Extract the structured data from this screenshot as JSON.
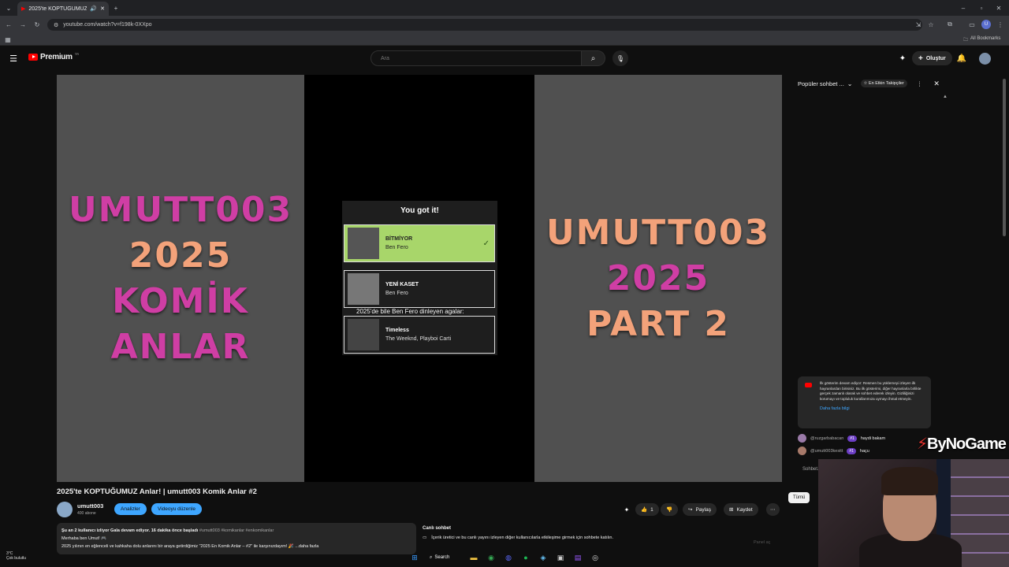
{
  "browser": {
    "tab_title": "2025'te KOPTUĞUMUZ Anlar",
    "url": "youtube.com/watch?v=f198k-0XXpo",
    "bookmarks_label": "All Bookmarks"
  },
  "header": {
    "logo_text": "Premium",
    "logo_region": "TR",
    "search_placeholder": "Ara",
    "create_label": "Oluştur"
  },
  "video": {
    "left_lines": [
      "UMUTT003",
      "2025",
      "KOMİK",
      "ANLAR"
    ],
    "right_lines": [
      "UMUTT003",
      "2025",
      "PART 2"
    ],
    "card_heading": "You got it!",
    "songs": [
      {
        "name": "BİTMİYOR",
        "artist": "Ben Fero"
      },
      {
        "name": "YENİ KASET",
        "artist": "Ben Fero"
      },
      {
        "name": "Timeless",
        "artist": "The Weeknd, Playboi Carti"
      }
    ],
    "caption": "2025'de bile Ben Fero dinleyen agalar:",
    "selected_check": "✓"
  },
  "info": {
    "title": "2025'te KOPTUĞUMUZ Anlar! | umutt003 Komik Anlar #2",
    "channel": "umutt003",
    "subscribers": "400 abone",
    "analytics_label": "Analizler",
    "edit_label": "Videoyu düzenle",
    "like_count": "1",
    "share_label": "Paylaş",
    "save_label": "Kaydet",
    "more_label": "⋯",
    "desc_line1_bold": "Şu an 2 kullanıcı izliyor  Gala devam ediyor. 16 dakika önce başladı",
    "desc_line1_tags": "#umutt003 #komikanlar #enkomikanlar",
    "desc_line2": "Merhaba ben Umut! 🎮",
    "desc_line3": "2025 yılının en eğlenceli ve kahkaha dolu anlarını bir araya getirdiğimiz \"2025 En Komik Anlar – #2\" ile karşınızdayım! 🎉  ...daha fazla"
  },
  "live_chat_info": {
    "label": "Canlı sohbet",
    "text": "İçerik üretici ve bu canlı yayını izleyen diğer kullanıcılarla etkileşime girmek için sohbete katılın.",
    "right_hint": "Panel aç"
  },
  "chat": {
    "header_label": "Popüler sohbet ...",
    "top_fans_label": "En Etkin Takipçiler",
    "notice_text": "İlk gösterim devam ediyor: Resmen bu yüklemeyi izleyen ilk hayranlardan birisiniz. Bu ilk gösterimi, diğer hayranlarla birlikte gerçek zamanlı olarak ve sohbet ederek izleyin. Gizliliğinizi korumayı ve topluluk kurallarımıza uymayı ihmal etmeyin.",
    "notice_more": "Daha fazla bilgi",
    "messages": [
      {
        "user": "@ruzgarbabacan",
        "badge": "#1",
        "text": "haydi bakam"
      },
      {
        "user": "@umutt003kesitt",
        "badge": "#1",
        "text": "haçu"
      }
    ],
    "input_hint": "Sohbet...",
    "all_label": "Tümü"
  },
  "overlay": {
    "brand": "ByNoGame"
  },
  "taskbar": {
    "temp": "3°C",
    "weather": "Çok bulutlu",
    "search_label": "Search"
  },
  "colors": {
    "accent_blue": "#3ea6ff",
    "youtube_red": "#ff0000",
    "title_pink": "#cf3ea4",
    "title_salmon": "#f3a27a",
    "selected_song": "#a8d66a"
  }
}
